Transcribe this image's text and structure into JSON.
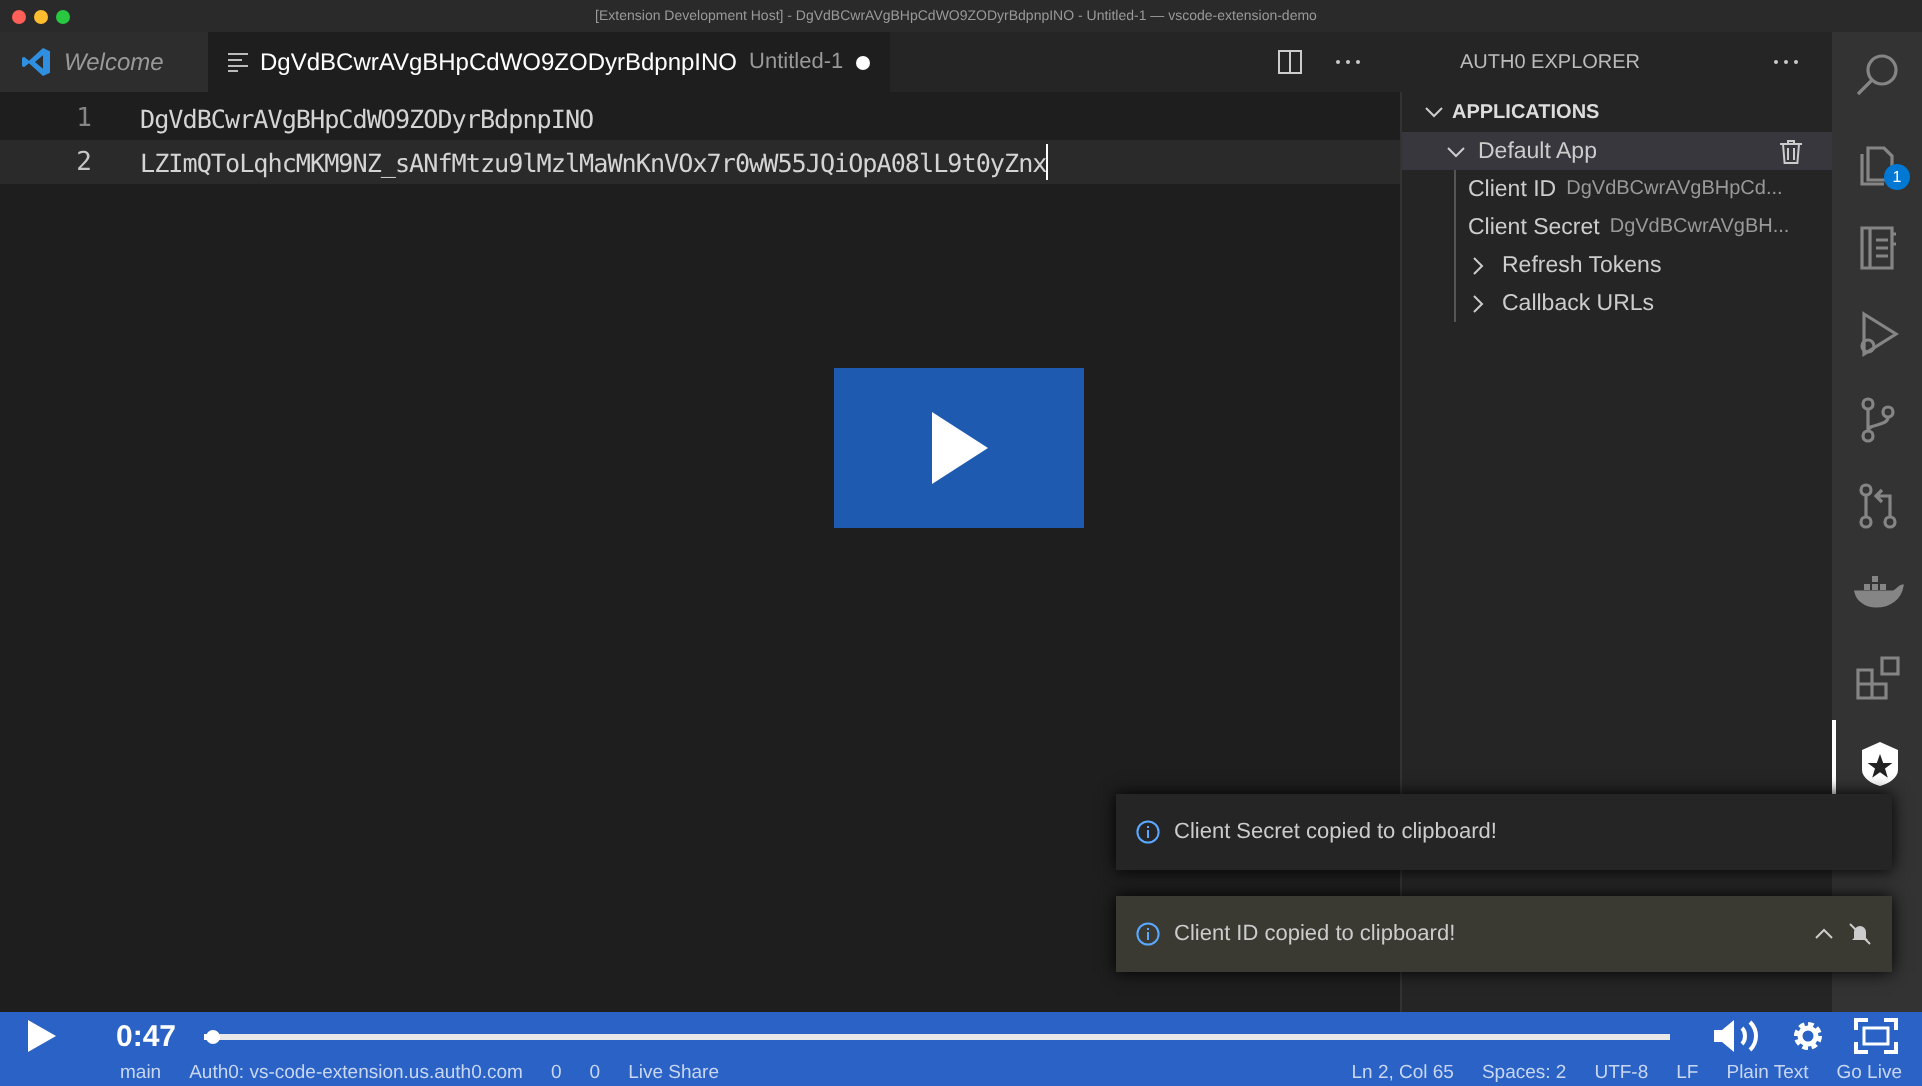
{
  "window": {
    "title": "[Extension Development Host] - DgVdBCwrAVgBHpCdWO9ZODyrBdpnpINO - Untitled-1 — vscode-extension-demo"
  },
  "tabs": [
    {
      "kind": "welcome",
      "label": "Welcome",
      "selected": false
    },
    {
      "kind": "file",
      "label": "DgVdBCwrAVgBHpCdWO9ZODyrBdpnpINO",
      "description": "Untitled-1",
      "selected": true,
      "dirty": true
    }
  ],
  "editor": {
    "lines": [
      {
        "number": "1",
        "text": "DgVdBCwrAVgBHpCdWO9ZODyrBdpnpINO",
        "current": false
      },
      {
        "number": "2",
        "text": "LZImQToLqhcMKM9NZ_sANfMtzu9lMzlMaWnKnVOx7r0wW55JQiOpA08lL9t0yZnx",
        "current": true
      }
    ]
  },
  "sidebar": {
    "title": "AUTH0 EXPLORER",
    "section": "APPLICATIONS",
    "tree": [
      {
        "label": "Default App",
        "expanded": true,
        "selected": true,
        "children": [
          {
            "label": "Client ID",
            "description": "DgVdBCwrAVgBHpCd..."
          },
          {
            "label": "Client Secret",
            "description": "DgVdBCwrAVgBH..."
          },
          {
            "label": "Refresh Tokens",
            "expanded": false
          },
          {
            "label": "Callback URLs",
            "expanded": false
          }
        ]
      }
    ]
  },
  "activity_bar": [
    {
      "kind": "search",
      "selected": false
    },
    {
      "kind": "files",
      "selected": false,
      "badge": "1"
    },
    {
      "kind": "notebook",
      "selected": false
    },
    {
      "kind": "debug",
      "selected": false
    },
    {
      "kind": "branch",
      "selected": false
    },
    {
      "kind": "pull",
      "selected": false
    },
    {
      "kind": "docker",
      "selected": false
    },
    {
      "kind": "extensions",
      "selected": false
    },
    {
      "kind": "shield",
      "selected": true
    }
  ],
  "notifications": [
    {
      "message": "Client Secret copied to clipboard!",
      "focused": false
    },
    {
      "message": "Client ID copied to clipboard!",
      "focused": true
    }
  ],
  "video": {
    "time": "0:47",
    "level": 0.005
  },
  "status_bar": [
    "main",
    "Auth0: vs-code-extension.us.auth0.com",
    "0",
    "0",
    "Live Share",
    "Ln 2, Col 65",
    "Spaces: 2",
    "UTF-8",
    "LF",
    "Plain Text",
    "Go Live"
  ]
}
